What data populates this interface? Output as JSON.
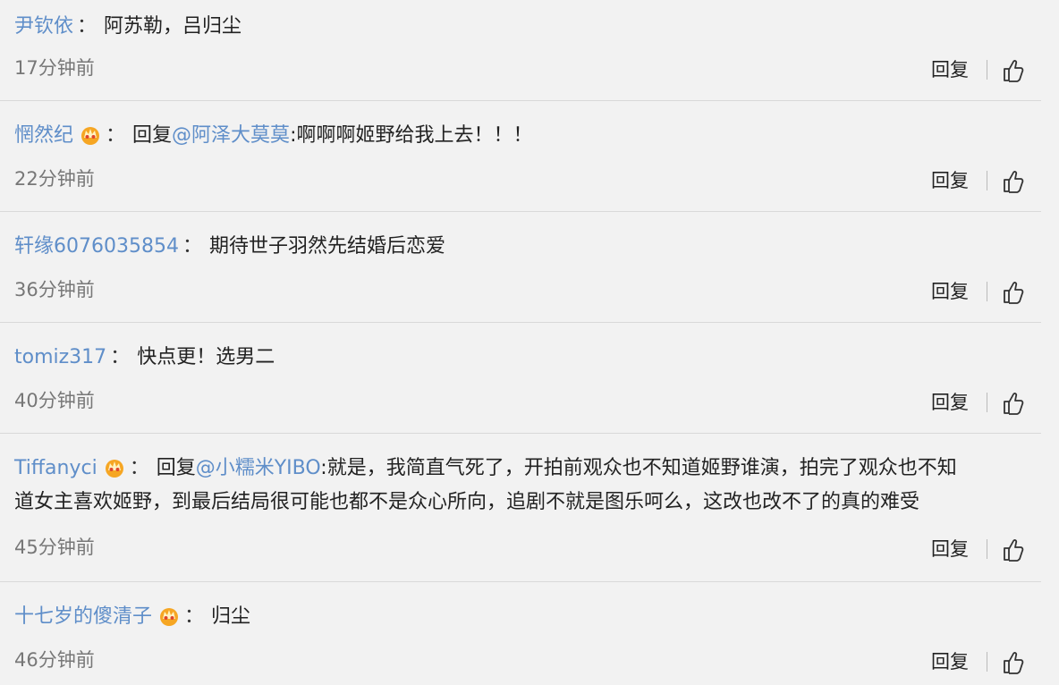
{
  "comments": [
    {
      "user": "尹钦依",
      "sep": "：",
      "crown": false,
      "reply_prefix": "",
      "reply_to": "",
      "text": "阿苏勒，吕归尘",
      "time": "17分钟前",
      "reply_label": "回复"
    },
    {
      "user": "惘然纪",
      "sep": "：",
      "crown": true,
      "reply_prefix": "回复",
      "reply_to": "@阿泽大莫莫",
      "text": ":啊啊啊姬野给我上去！！！",
      "time": "22分钟前",
      "reply_label": "回复"
    },
    {
      "user": "轩缘6076035854",
      "sep": "：",
      "crown": false,
      "reply_prefix": "",
      "reply_to": "",
      "text": "期待世子羽然先结婚后恋爱",
      "time": "36分钟前",
      "reply_label": "回复"
    },
    {
      "user": "tomiz317",
      "sep": "：",
      "crown": false,
      "reply_prefix": "",
      "reply_to": "",
      "text": "快点更！选男二",
      "time": "40分钟前",
      "reply_label": "回复"
    },
    {
      "user": "Tiffanyci",
      "sep": "：",
      "crown": true,
      "reply_prefix": "回复",
      "reply_to": "@小糯米YIBO",
      "text": ":就是，我简直气死了，开拍前观众也不知道姬野谁演，拍完了观众也不知",
      "text2": "道女主喜欢姬野，到最后结局很可能也都不是众心所向，追剧不就是图乐呵么，这改也改不了的真的难受",
      "time": "45分钟前",
      "reply_label": "回复"
    },
    {
      "user": "十七岁的傻清子",
      "sep": "：",
      "crown": true,
      "reply_prefix": "",
      "reply_to": "",
      "text": "归尘",
      "time": "46分钟前",
      "reply_label": "回复"
    }
  ],
  "colors": {
    "username": "#5f8ec9",
    "background": "#f2f2f2",
    "divider": "#d9d9d9"
  },
  "icons": {
    "crown": "crown-badge-icon",
    "like": "thumbs-up-icon"
  }
}
